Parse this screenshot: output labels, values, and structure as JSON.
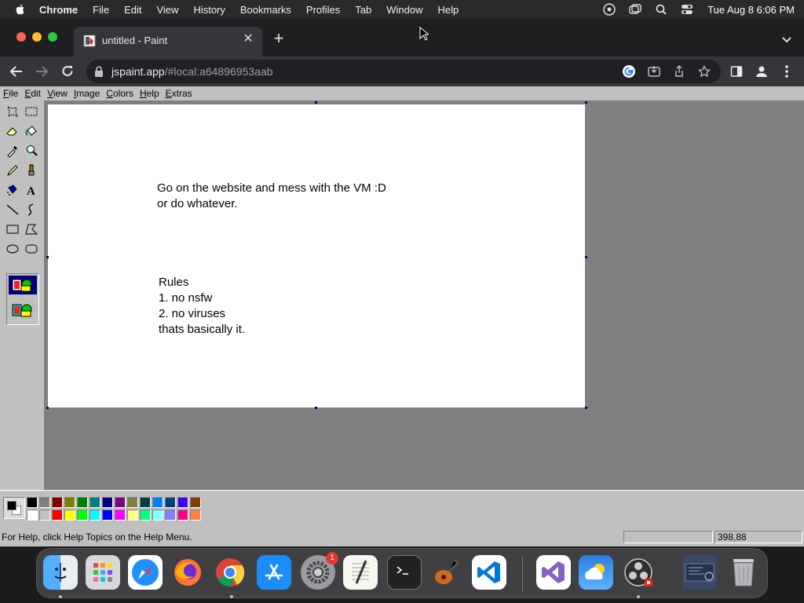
{
  "mac_menubar": {
    "app_name": "Chrome",
    "items": [
      "File",
      "Edit",
      "View",
      "History",
      "Bookmarks",
      "Profiles",
      "Tab",
      "Window",
      "Help"
    ],
    "clock": "Tue Aug 8  6:06 PM"
  },
  "browser": {
    "tab_title": "untitled - Paint",
    "new_tab_label": "+",
    "url_host": "jspaint.app",
    "url_path": "/#local:a64896953aab"
  },
  "paint": {
    "menu": [
      "File",
      "Edit",
      "View",
      "Image",
      "Colors",
      "Help",
      "Extras"
    ],
    "canvas_text": {
      "line1": "Go on the website and mess with the VM :D",
      "line2": "or do whatever.",
      "rules_title": "Rules",
      "rule1": "1. no nsfw",
      "rule2": "2. no viruses",
      "rule3": "thats basically it."
    },
    "palette_top": [
      "#000000",
      "#808080",
      "#800000",
      "#808000",
      "#008000",
      "#008080",
      "#000080",
      "#800080",
      "#808040",
      "#004040",
      "#0080ff",
      "#004080",
      "#4000ff",
      "#804000"
    ],
    "palette_bottom": [
      "#ffffff",
      "#c0c0c0",
      "#ff0000",
      "#ffff00",
      "#00ff00",
      "#00ffff",
      "#0000ff",
      "#ff00ff",
      "#ffff80",
      "#00ff80",
      "#80ffff",
      "#8080ff",
      "#ff0080",
      "#ff8040"
    ],
    "foreground_color": "#000000",
    "background_color": "#ffffff",
    "status_help": "For Help, click Help Topics on the Help Menu.",
    "status_coords": "398,88"
  },
  "dock": {
    "apps": [
      "finder-icon",
      "launchpad-icon",
      "safari-icon",
      "firefox-icon",
      "chrome-icon",
      "app-store-icon",
      "system-settings-icon",
      "textedit-icon",
      "terminal-icon",
      "garageband-icon",
      "vscode-icon",
      "visual-studio-icon",
      "weather-icon",
      "obs-icon"
    ],
    "settings_badge": "1"
  }
}
